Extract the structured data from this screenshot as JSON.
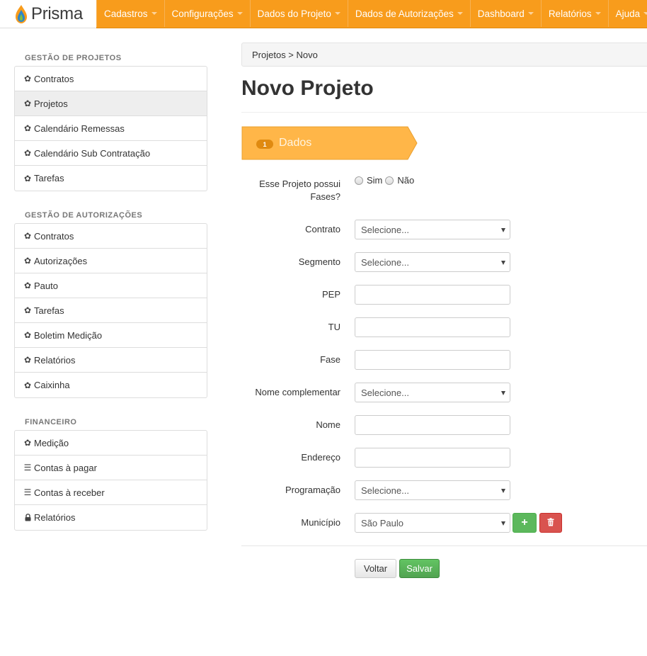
{
  "brand": {
    "name": "Prisma",
    "logo_icon": "flame-drop-logo"
  },
  "nav": {
    "items": [
      {
        "label": "Cadastros"
      },
      {
        "label": "Configurações"
      },
      {
        "label": "Dados do Projeto"
      },
      {
        "label": "Dados de Autorizações"
      },
      {
        "label": "Dashboard"
      },
      {
        "label": "Relatórios"
      },
      {
        "label": "Ajuda"
      }
    ]
  },
  "sidebar": {
    "groups": [
      {
        "heading": "GESTÃO DE PROJETOS",
        "items": [
          {
            "label": "Contratos",
            "icon": "gear-icon"
          },
          {
            "label": "Projetos",
            "icon": "gear-icon",
            "active": true
          },
          {
            "label": "Calendário Remessas",
            "icon": "gear-icon"
          },
          {
            "label": "Calendário Sub Contratação",
            "icon": "gear-icon"
          },
          {
            "label": "Tarefas",
            "icon": "gear-icon"
          }
        ]
      },
      {
        "heading": "GESTÃO DE AUTORIZAÇÕES",
        "items": [
          {
            "label": "Contratos",
            "icon": "gear-icon"
          },
          {
            "label": "Autorizações",
            "icon": "gear-icon"
          },
          {
            "label": "Pauto",
            "icon": "gear-icon"
          },
          {
            "label": "Tarefas",
            "icon": "gear-icon"
          },
          {
            "label": "Boletim Medição",
            "icon": "gear-icon"
          },
          {
            "label": "Relatórios",
            "icon": "gear-icon"
          },
          {
            "label": "Caixinha",
            "icon": "gear-icon"
          }
        ]
      },
      {
        "heading": "FINANCEIRO",
        "items": [
          {
            "label": "Medição",
            "icon": "gear-icon"
          },
          {
            "label": "Contas à pagar",
            "icon": "list-icon"
          },
          {
            "label": "Contas à receber",
            "icon": "list-icon"
          },
          {
            "label": "Relatórios",
            "icon": "lock-icon"
          }
        ]
      }
    ]
  },
  "breadcrumb": {
    "text": "Projetos > Novo"
  },
  "page": {
    "title": "Novo Projeto"
  },
  "wizard": {
    "step_number": "1",
    "step_label": "Dados"
  },
  "form": {
    "fases": {
      "label_line1": "Esse Projeto possui",
      "label_line2": "Fases?",
      "option_yes": "Sim",
      "option_no": "Não"
    },
    "contrato": {
      "label": "Contrato",
      "value": "Selecione..."
    },
    "segmento": {
      "label": "Segmento",
      "value": "Selecione..."
    },
    "pep": {
      "label": "PEP",
      "value": ""
    },
    "tu": {
      "label": "TU",
      "value": ""
    },
    "fase": {
      "label": "Fase",
      "value": ""
    },
    "nome_complementar": {
      "label": "Nome complementar",
      "value": "Selecione..."
    },
    "nome": {
      "label": "Nome",
      "value": ""
    },
    "endereco": {
      "label": "Endereço",
      "value": ""
    },
    "programacao": {
      "label": "Programação",
      "value": "Selecione..."
    },
    "municipio": {
      "label": "Município",
      "value": "São Paulo"
    }
  },
  "actions": {
    "back_label": "Voltar",
    "save_label": "Salvar"
  },
  "colors": {
    "accent": "#f89c1c",
    "step": "#ffb648",
    "success": "#5cb85c",
    "danger": "#d9534f"
  }
}
